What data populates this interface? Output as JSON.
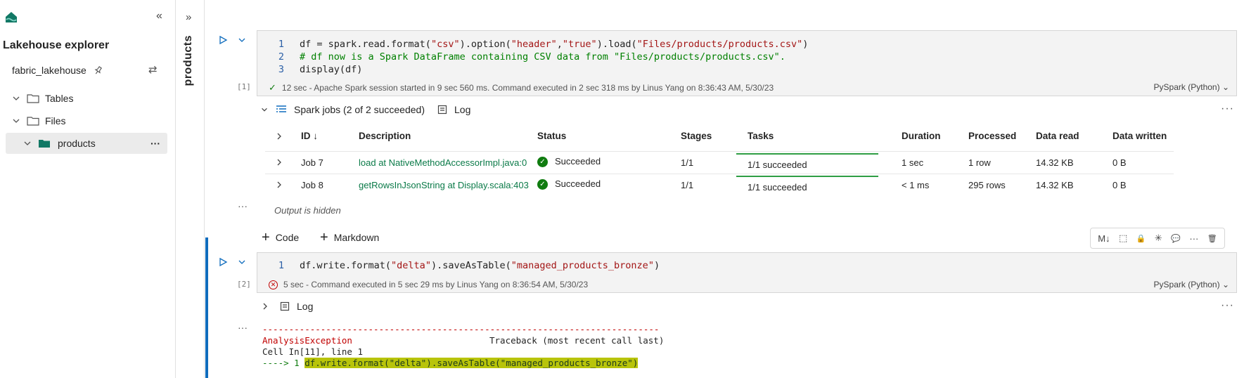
{
  "explorer": {
    "title": "Lakehouse explorer",
    "lakehouse_name": "fabric_lakehouse",
    "tree": [
      {
        "label": "Tables",
        "expanded": true
      },
      {
        "label": "Files",
        "expanded": true
      },
      {
        "label": "products",
        "expanded": true,
        "selected": true
      }
    ],
    "more": "···"
  },
  "strip": {
    "label": "products"
  },
  "cell1": {
    "exec_count": "[1]",
    "lines": [
      {
        "n": "1",
        "parts": [
          {
            "t": "df = spark.read.format(",
            "c": ""
          },
          {
            "t": "\"csv\"",
            "c": "str"
          },
          {
            "t": ").option(",
            "c": ""
          },
          {
            "t": "\"header\"",
            "c": "str"
          },
          {
            "t": ",",
            "c": ""
          },
          {
            "t": "\"true\"",
            "c": "str"
          },
          {
            "t": ").load(",
            "c": ""
          },
          {
            "t": "\"Files/products/products.csv\"",
            "c": "str"
          },
          {
            "t": ")",
            "c": ""
          }
        ]
      },
      {
        "n": "2",
        "parts": [
          {
            "t": "# df now is a Spark DataFrame containing CSV data from \"Files/products/products.csv\".",
            "c": "cmt"
          }
        ]
      },
      {
        "n": "3",
        "parts": [
          {
            "t": "display(df)",
            "c": ""
          }
        ]
      }
    ],
    "status": "12 sec - Apache Spark session started in 9 sec 560 ms. Command executed in 2 sec 318 ms by Linus Yang on 8:36:43 AM, 5/30/23",
    "language": "PySpark (Python)"
  },
  "jobs": {
    "title": "Spark jobs (2 of 2 succeeded)",
    "log_label": "Log",
    "columns": [
      "ID",
      "Description",
      "Status",
      "Stages",
      "Tasks",
      "Duration",
      "Processed",
      "Data read",
      "Data written"
    ],
    "rows": [
      {
        "id": "Job 7",
        "description": "load at NativeMethodAccessorImpl.java:0",
        "status": "Succeeded",
        "stages": "1/1",
        "tasks": "1/1 succeeded",
        "duration": "1 sec",
        "processed": "1 row",
        "data_read": "14.32 KB",
        "data_written": "0 B"
      },
      {
        "id": "Job 8",
        "description": "getRowsInJsonString at Display.scala:403",
        "status": "Succeeded",
        "stages": "1/1",
        "tasks": "1/1 succeeded",
        "duration": "< 1 ms",
        "processed": "295 rows",
        "data_read": "14.32 KB",
        "data_written": "0 B"
      }
    ],
    "output_hidden": "Output is hidden"
  },
  "add": {
    "code": "Code",
    "markdown": "Markdown"
  },
  "cell_toolbar": [
    "M↓",
    "⬚",
    "🔒",
    "✳",
    "💬",
    "···",
    "🗑"
  ],
  "cell2": {
    "exec_count": "[2]",
    "lines": [
      {
        "n": "1",
        "parts": [
          {
            "t": "df.write.format(",
            "c": ""
          },
          {
            "t": "\"delta\"",
            "c": "str"
          },
          {
            "t": ").saveAsTable(",
            "c": ""
          },
          {
            "t": "\"managed_products_bronze\"",
            "c": "str"
          },
          {
            "t": ")",
            "c": ""
          }
        ]
      }
    ],
    "status": "5 sec - Command executed in 5 sec 29 ms by Linus Yang on 8:36:54 AM, 5/30/23",
    "language": "PySpark (Python)",
    "log_label": "Log",
    "error": {
      "divider": "---------------------------------------------------------------------------",
      "exception": "AnalysisException",
      "traceback": "Traceback (most recent call last)",
      "cell_ref": "Cell In[11], line 1",
      "arrow": "----> 1 ",
      "code": "df.write.format(\"delta\").saveAsTable(\"managed_products_bronze\")"
    }
  },
  "colors": {
    "accent": "#0f6cbd",
    "success": "#107c10",
    "error": "#c00000",
    "highlight": "#b8c40a"
  }
}
